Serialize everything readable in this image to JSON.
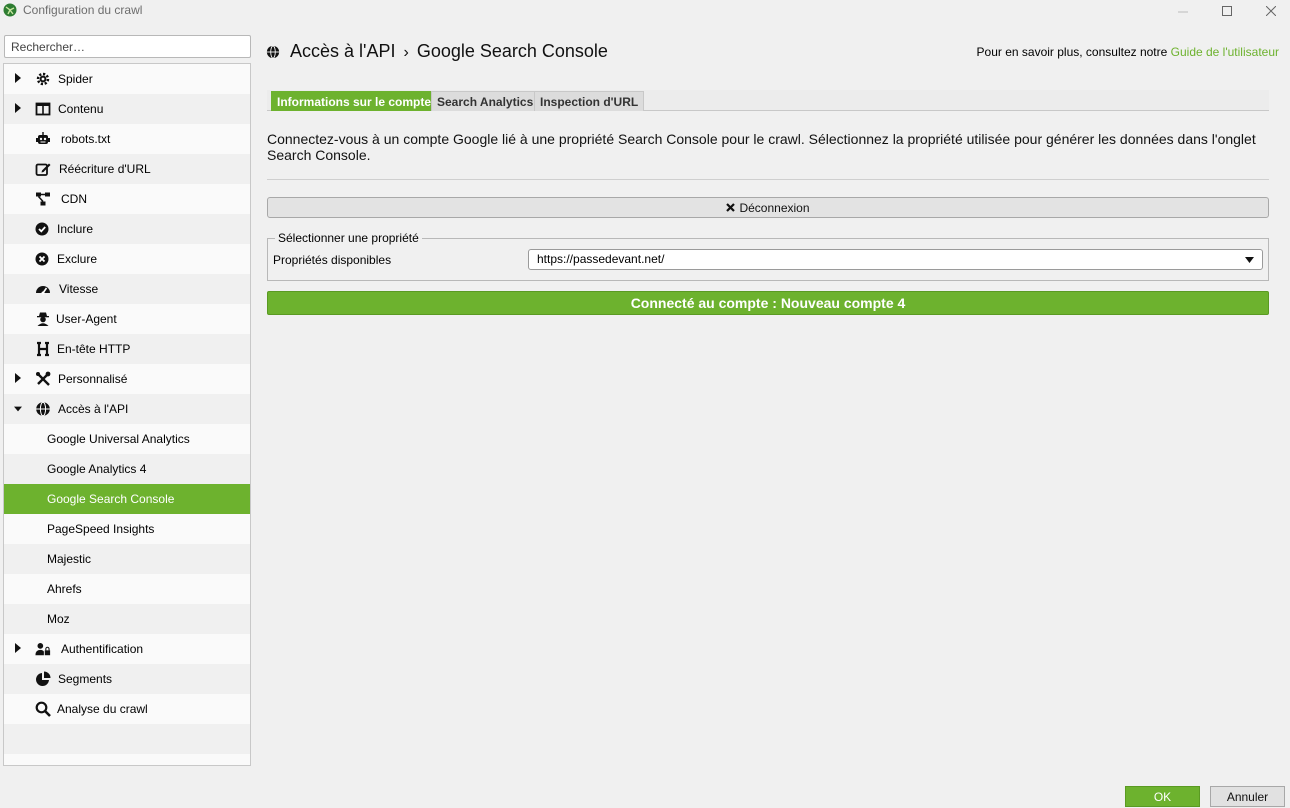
{
  "window": {
    "title": "Configuration du crawl"
  },
  "sidebar": {
    "search_placeholder": "Rechercher…",
    "items": [
      {
        "label": "Spider",
        "icon": "gear-icon"
      },
      {
        "label": "Contenu",
        "icon": "columns-icon"
      },
      {
        "label": "robots.txt",
        "icon": "robot-icon"
      },
      {
        "label": "Réécriture d'URL",
        "icon": "edit-icon"
      },
      {
        "label": "CDN",
        "icon": "network-icon"
      },
      {
        "label": "Inclure",
        "icon": "check-circle-icon"
      },
      {
        "label": "Exclure",
        "icon": "x-circle-icon"
      },
      {
        "label": "Vitesse",
        "icon": "gauge-icon"
      },
      {
        "label": "User-Agent",
        "icon": "user-secret-icon"
      },
      {
        "label": "En-tête HTTP",
        "icon": "heading-icon"
      },
      {
        "label": "Personnalisé",
        "icon": "tools-icon"
      },
      {
        "label": "Accès à l'API",
        "icon": "globe-icon"
      },
      {
        "label": "Google Universal Analytics"
      },
      {
        "label": "Google Analytics 4"
      },
      {
        "label": "Google Search Console"
      },
      {
        "label": "PageSpeed Insights"
      },
      {
        "label": "Majestic"
      },
      {
        "label": "Ahrefs"
      },
      {
        "label": "Moz"
      },
      {
        "label": "Authentification",
        "icon": "user-lock-icon"
      },
      {
        "label": "Segments",
        "icon": "pie-chart-icon"
      },
      {
        "label": "Analyse du crawl",
        "icon": "search-icon"
      }
    ]
  },
  "header": {
    "section": "Accès à l'API",
    "separator": "›",
    "page": "Google Search Console",
    "guide_prefix": "Pour en savoir plus, consultez notre ",
    "guide_link": "Guide de l'utilisateur"
  },
  "tabs": [
    {
      "label": "Informations sur le compte",
      "active": true
    },
    {
      "label": "Search Analytics",
      "active": false
    },
    {
      "label": "Inspection d'URL",
      "active": false
    }
  ],
  "main": {
    "description": "Connectez-vous à un compte Google lié à une propriété Search Console pour le crawl. Sélectionnez la propriété utilisée pour générer les données dans l'onglet Search Console.",
    "disconnect_label": "Déconnexion",
    "property_group_legend": "Sélectionner une propriété",
    "properties_label": "Propriétés disponibles",
    "selected_property": "https://passedevant.net/",
    "status": "Connecté au compte : Nouveau compte 4"
  },
  "footer": {
    "ok_label": "OK",
    "cancel_label": "Annuler"
  },
  "colors": {
    "accent": "#6db22e"
  }
}
